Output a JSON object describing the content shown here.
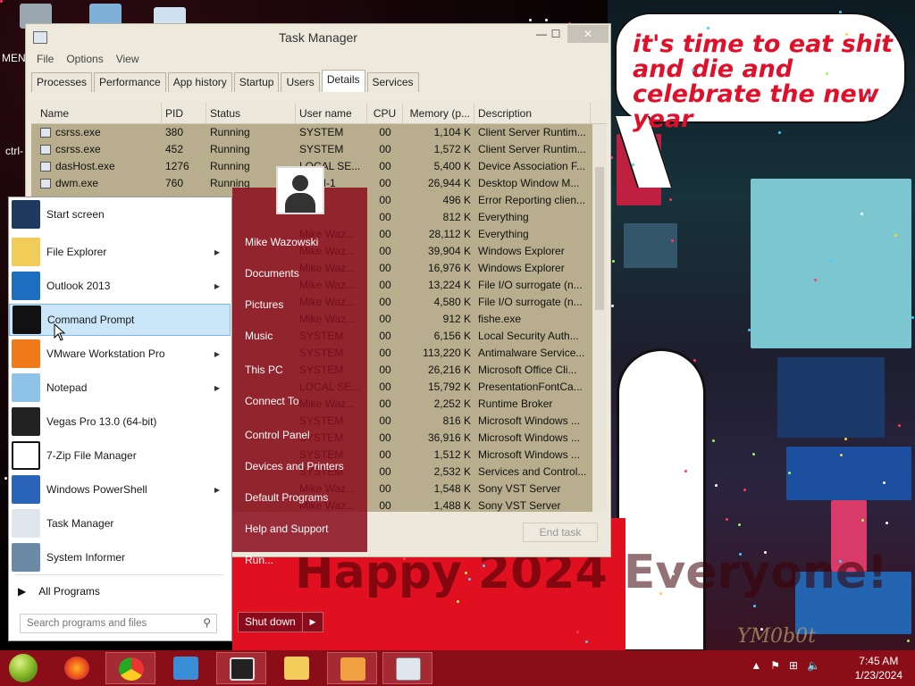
{
  "desktop": {
    "wallpaper": {
      "speech_text": "it's time to eat shit and die and celebrate the new year",
      "banner_text": "Happy 2024 Everyone!",
      "watermark": "YM0b0t"
    },
    "icons": [
      "recycle-bin",
      "media-player",
      "computer"
    ],
    "left_labels": [
      "MEN",
      "ctrl-"
    ]
  },
  "task_manager": {
    "title": "Task Manager",
    "window_buttons": {
      "minimize": "—",
      "maximize": "☐",
      "close": "✕"
    },
    "menu": [
      "File",
      "Options",
      "View"
    ],
    "tabs": [
      "Processes",
      "Performance",
      "App history",
      "Startup",
      "Users",
      "Details",
      "Services"
    ],
    "active_tab": "Details",
    "columns": [
      "Name",
      "PID",
      "Status",
      "User name",
      "CPU",
      "Memory (p...",
      "Description"
    ],
    "rows": [
      {
        "name": "csrss.exe",
        "pid": "380",
        "status": "Running",
        "user": "SYSTEM",
        "cpu": "00",
        "mem": "1,104 K",
        "desc": "Client Server Runtim..."
      },
      {
        "name": "csrss.exe",
        "pid": "452",
        "status": "Running",
        "user": "SYSTEM",
        "cpu": "00",
        "mem": "1,572 K",
        "desc": "Client Server Runtim..."
      },
      {
        "name": "dasHost.exe",
        "pid": "1276",
        "status": "Running",
        "user": "LOCAL SE...",
        "cpu": "00",
        "mem": "5,400 K",
        "desc": "Device Association F..."
      },
      {
        "name": "dwm.exe",
        "pid": "760",
        "status": "Running",
        "user": "DWM-1",
        "cpu": "00",
        "mem": "26,944 K",
        "desc": "Desktop Window M..."
      },
      {
        "name": "",
        "pid": "",
        "status": "",
        "user": "",
        "cpu": "00",
        "mem": "496 K",
        "desc": "Error Reporting clien..."
      },
      {
        "name": "",
        "pid": "",
        "status": "",
        "user": "",
        "cpu": "00",
        "mem": "812 K",
        "desc": "Everything"
      },
      {
        "name": "",
        "pid": "",
        "status": "",
        "user": "Mike Waz...",
        "cpu": "00",
        "mem": "28,112 K",
        "desc": "Everything"
      },
      {
        "name": "",
        "pid": "",
        "status": "",
        "user": "Mike Waz...",
        "cpu": "00",
        "mem": "39,904 K",
        "desc": "Windows Explorer"
      },
      {
        "name": "",
        "pid": "",
        "status": "",
        "user": "Mike Waz...",
        "cpu": "00",
        "mem": "16,976 K",
        "desc": "Windows Explorer"
      },
      {
        "name": "",
        "pid": "",
        "status": "",
        "user": "Mike Waz...",
        "cpu": "00",
        "mem": "13,224 K",
        "desc": "File I/O surrogate (n..."
      },
      {
        "name": "",
        "pid": "",
        "status": "",
        "user": "Mike Waz...",
        "cpu": "00",
        "mem": "4,580 K",
        "desc": "File I/O surrogate (n..."
      },
      {
        "name": "",
        "pid": "",
        "status": "",
        "user": "Mike Waz...",
        "cpu": "00",
        "mem": "912 K",
        "desc": "fishe.exe"
      },
      {
        "name": "",
        "pid": "",
        "status": "",
        "user": "SYSTEM",
        "cpu": "00",
        "mem": "6,156 K",
        "desc": "Local Security Auth..."
      },
      {
        "name": "",
        "pid": "",
        "status": "",
        "user": "SYSTEM",
        "cpu": "00",
        "mem": "113,220 K",
        "desc": "Antimalware Service..."
      },
      {
        "name": "",
        "pid": "",
        "status": "",
        "user": "SYSTEM",
        "cpu": "00",
        "mem": "26,216 K",
        "desc": "Microsoft Office Cli..."
      },
      {
        "name": "",
        "pid": "",
        "status": "",
        "user": "LOCAL SE...",
        "cpu": "00",
        "mem": "15,792 K",
        "desc": "PresentationFontCa..."
      },
      {
        "name": "",
        "pid": "",
        "status": "",
        "user": "Mike Waz...",
        "cpu": "00",
        "mem": "2,252 K",
        "desc": "Runtime Broker"
      },
      {
        "name": "",
        "pid": "",
        "status": "",
        "user": "SYSTEM",
        "cpu": "00",
        "mem": "816 K",
        "desc": "Microsoft Windows ..."
      },
      {
        "name": "",
        "pid": "",
        "status": "",
        "user": "SYSTEM",
        "cpu": "00",
        "mem": "36,916 K",
        "desc": "Microsoft Windows ..."
      },
      {
        "name": "",
        "pid": "",
        "status": "",
        "user": "SYSTEM",
        "cpu": "00",
        "mem": "1,512 K",
        "desc": "Microsoft Windows ..."
      },
      {
        "name": "",
        "pid": "",
        "status": "",
        "user": "SYSTEM",
        "cpu": "00",
        "mem": "2,532 K",
        "desc": "Services and Control..."
      },
      {
        "name": "",
        "pid": "",
        "status": "",
        "user": "Mike Waz...",
        "cpu": "00",
        "mem": "1,548 K",
        "desc": "Sony VST Server"
      },
      {
        "name": "",
        "pid": "",
        "status": "",
        "user": "Mike Waz...",
        "cpu": "00",
        "mem": "1,488 K",
        "desc": "Sony VST Server"
      }
    ],
    "end_task": "End task"
  },
  "start_menu": {
    "pinned": [
      {
        "label": "Start screen",
        "icon": "start-screen-icon",
        "arrow": false
      },
      {
        "label": "File Explorer",
        "icon": "folder-icon",
        "arrow": true
      },
      {
        "label": "Outlook 2013",
        "icon": "outlook-icon",
        "arrow": true
      },
      {
        "label": "Command Prompt",
        "icon": "cmd-icon",
        "arrow": false
      },
      {
        "label": "VMware Workstation Pro",
        "icon": "vmware-icon",
        "arrow": true
      },
      {
        "label": "Notepad",
        "icon": "notepad-icon",
        "arrow": true
      },
      {
        "label": "Vegas Pro 13.0 (64-bit)",
        "icon": "vegas-icon",
        "arrow": false
      },
      {
        "label": "7-Zip File Manager",
        "icon": "7zip-icon",
        "arrow": false
      },
      {
        "label": "Windows PowerShell",
        "icon": "powershell-icon",
        "arrow": true
      },
      {
        "label": "Task Manager",
        "icon": "task-manager-icon",
        "arrow": false
      },
      {
        "label": "System Informer",
        "icon": "system-informer-icon",
        "arrow": false
      }
    ],
    "all_programs": "All Programs",
    "search_placeholder": "Search programs and files",
    "user_name": "Mike Wazowski",
    "right_items": [
      "Documents",
      "Pictures",
      "Music",
      "This PC",
      "Connect To",
      "Control Panel",
      "Devices and Printers",
      "Default Programs",
      "Help and Support",
      "Run..."
    ],
    "shutdown": "Shut down"
  },
  "taskbar": {
    "apps": [
      "firefox",
      "chrome",
      "media-player",
      "vegas",
      "file-explorer",
      "media-center",
      "task-manager"
    ],
    "time": "7:45 AM",
    "date": "1/23/2024"
  }
}
